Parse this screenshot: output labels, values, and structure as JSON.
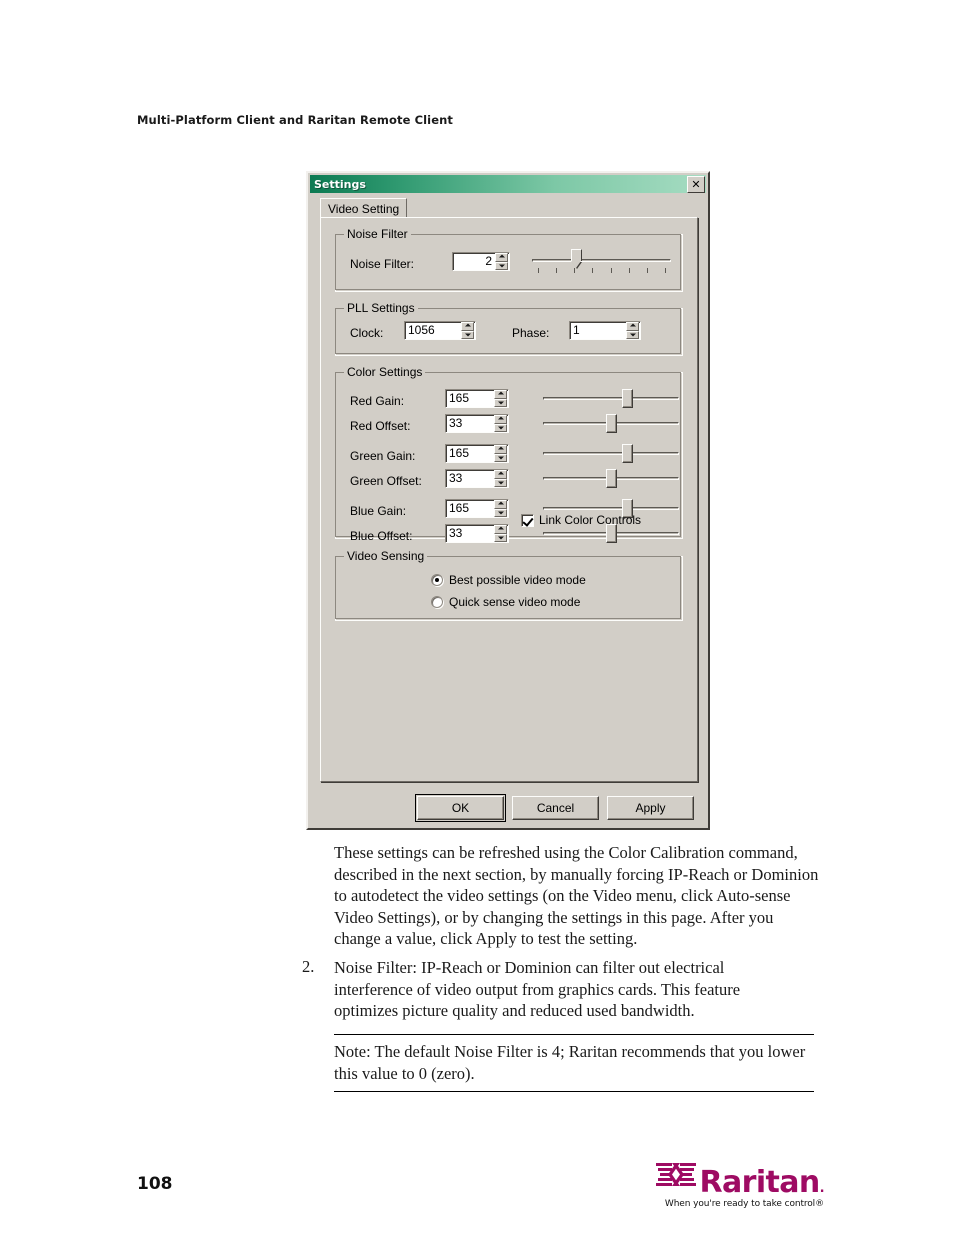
{
  "page": {
    "header": "Multi-Platform Client and Raritan Remote Client",
    "number": "108",
    "logo_word": "Raritan",
    "logo_reg": ".",
    "logo_tagline": "When you're ready to take control®"
  },
  "dialog": {
    "title": "Settings",
    "close_label": "✕",
    "tab": {
      "label": "Video Setting"
    },
    "noise_filter": {
      "group_label": "Noise Filter",
      "field_label": "Noise Filter:",
      "value": "2",
      "slider_percent": 32,
      "tick_count": 8
    },
    "pll": {
      "group_label": "PLL Settings",
      "clock_label": "Clock:",
      "clock_value": "1056",
      "phase_label": "Phase:",
      "phase_value": "1"
    },
    "color": {
      "group_label": "Color Settings",
      "rows": [
        {
          "label": "Red Gain:",
          "value": "165",
          "percent": 62
        },
        {
          "label": "Red Offset:",
          "value": "33",
          "percent": 50
        },
        {
          "label": "Green Gain:",
          "value": "165",
          "percent": 62
        },
        {
          "label": "Green Offset:",
          "value": "33",
          "percent": 50
        },
        {
          "label": "Blue Gain:",
          "value": "165",
          "percent": 62
        },
        {
          "label": "Blue Offset:",
          "value": "33",
          "percent": 50
        }
      ],
      "link_checkbox_label": "Link Color Controls",
      "link_checkbox_checked": true
    },
    "video_sensing": {
      "group_label": "Video Sensing",
      "options": [
        {
          "label": "Best possible video mode",
          "selected": true
        },
        {
          "label": "Quick sense video mode",
          "selected": false
        }
      ]
    },
    "buttons": {
      "ok": "OK",
      "cancel": "Cancel",
      "apply": "Apply"
    }
  },
  "content": {
    "paragraph1": "These settings can be refreshed using the Color Calibration command, described in the next section, by manually forcing IP-Reach or Dominion to autodetect the video settings (on the Video menu, click Auto-sense Video Settings), or by changing the settings in this page. After you change a value, click Apply to test the setting.",
    "item2_number": "2.",
    "item2_text": "Noise Filter: IP-Reach or Dominion can filter out electrical interference of video output from graphics cards. This feature optimizes picture quality and reduced used bandwidth.",
    "note": "Note: The default Noise Filter is 4; Raritan recommends that you lower this value to 0 (zero)."
  }
}
